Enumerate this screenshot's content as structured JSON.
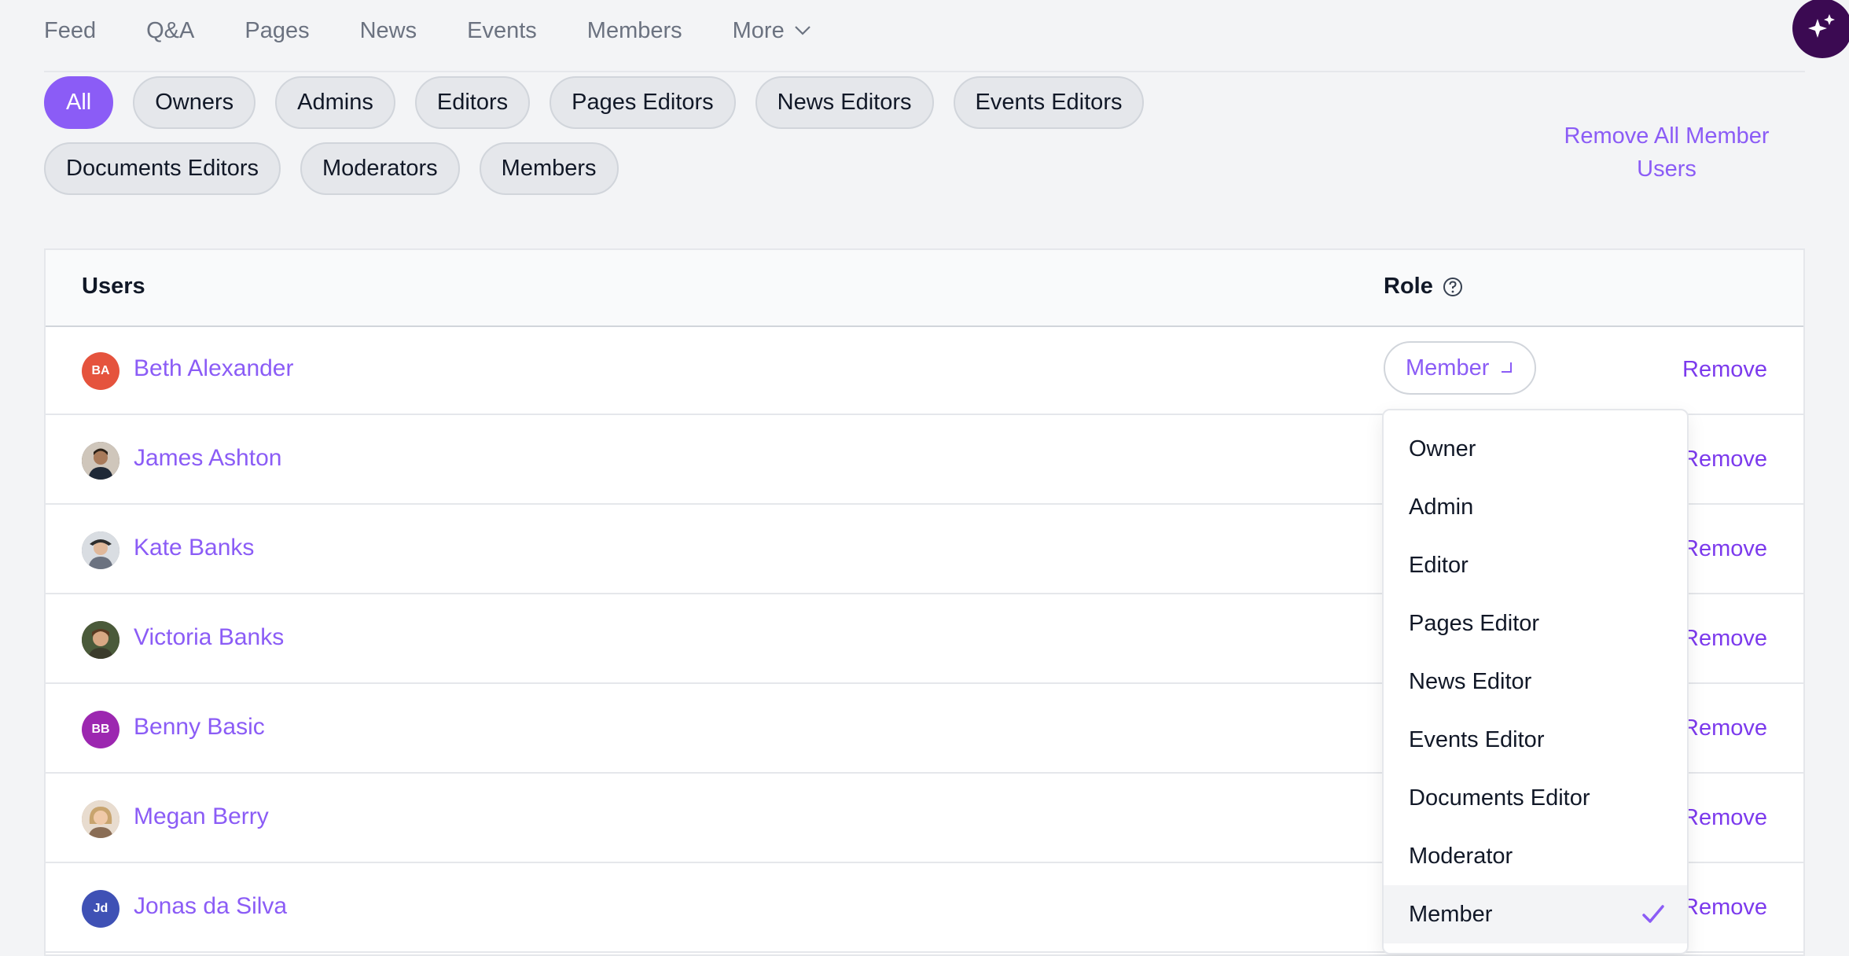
{
  "nav": {
    "items": [
      "Feed",
      "Q&A",
      "Pages",
      "News",
      "Events",
      "Members"
    ],
    "more_label": "More"
  },
  "filters": {
    "chips": [
      "All",
      "Owners",
      "Admins",
      "Editors",
      "Pages Editors",
      "News Editors",
      "Events Editors",
      "Documents Editors",
      "Moderators",
      "Members"
    ],
    "active": "All",
    "remove_all_label": "Remove All Member Users"
  },
  "table": {
    "header_users": "Users",
    "header_role": "Role",
    "role_button_label": "Member",
    "remove_label": "Remove",
    "rows": [
      {
        "name": "Beth Alexander",
        "initials": "BA",
        "avatar_color": "#e5533d"
      },
      {
        "name": "James Ashton",
        "initials": "",
        "avatar_color": "#4b3a2f"
      },
      {
        "name": "Kate Banks",
        "initials": "",
        "avatar_color": "#8a8f98"
      },
      {
        "name": "Victoria Banks",
        "initials": "",
        "avatar_color": "#5c4a2e"
      },
      {
        "name": "Benny Basic",
        "initials": "BB",
        "avatar_color": "#9c27b0"
      },
      {
        "name": "Megan Berry",
        "initials": "",
        "avatar_color": "#b89a7a"
      },
      {
        "name": "Jonas da Silva",
        "initials": "Jd",
        "avatar_color": "#3f51b5"
      }
    ]
  },
  "role_dropdown": {
    "options": [
      "Owner",
      "Admin",
      "Editor",
      "Pages Editor",
      "News Editor",
      "Events Editor",
      "Documents Editor",
      "Moderator",
      "Member"
    ],
    "selected": "Member"
  },
  "colors": {
    "accent": "#8b5cf6",
    "fab": "#3b0a52"
  }
}
